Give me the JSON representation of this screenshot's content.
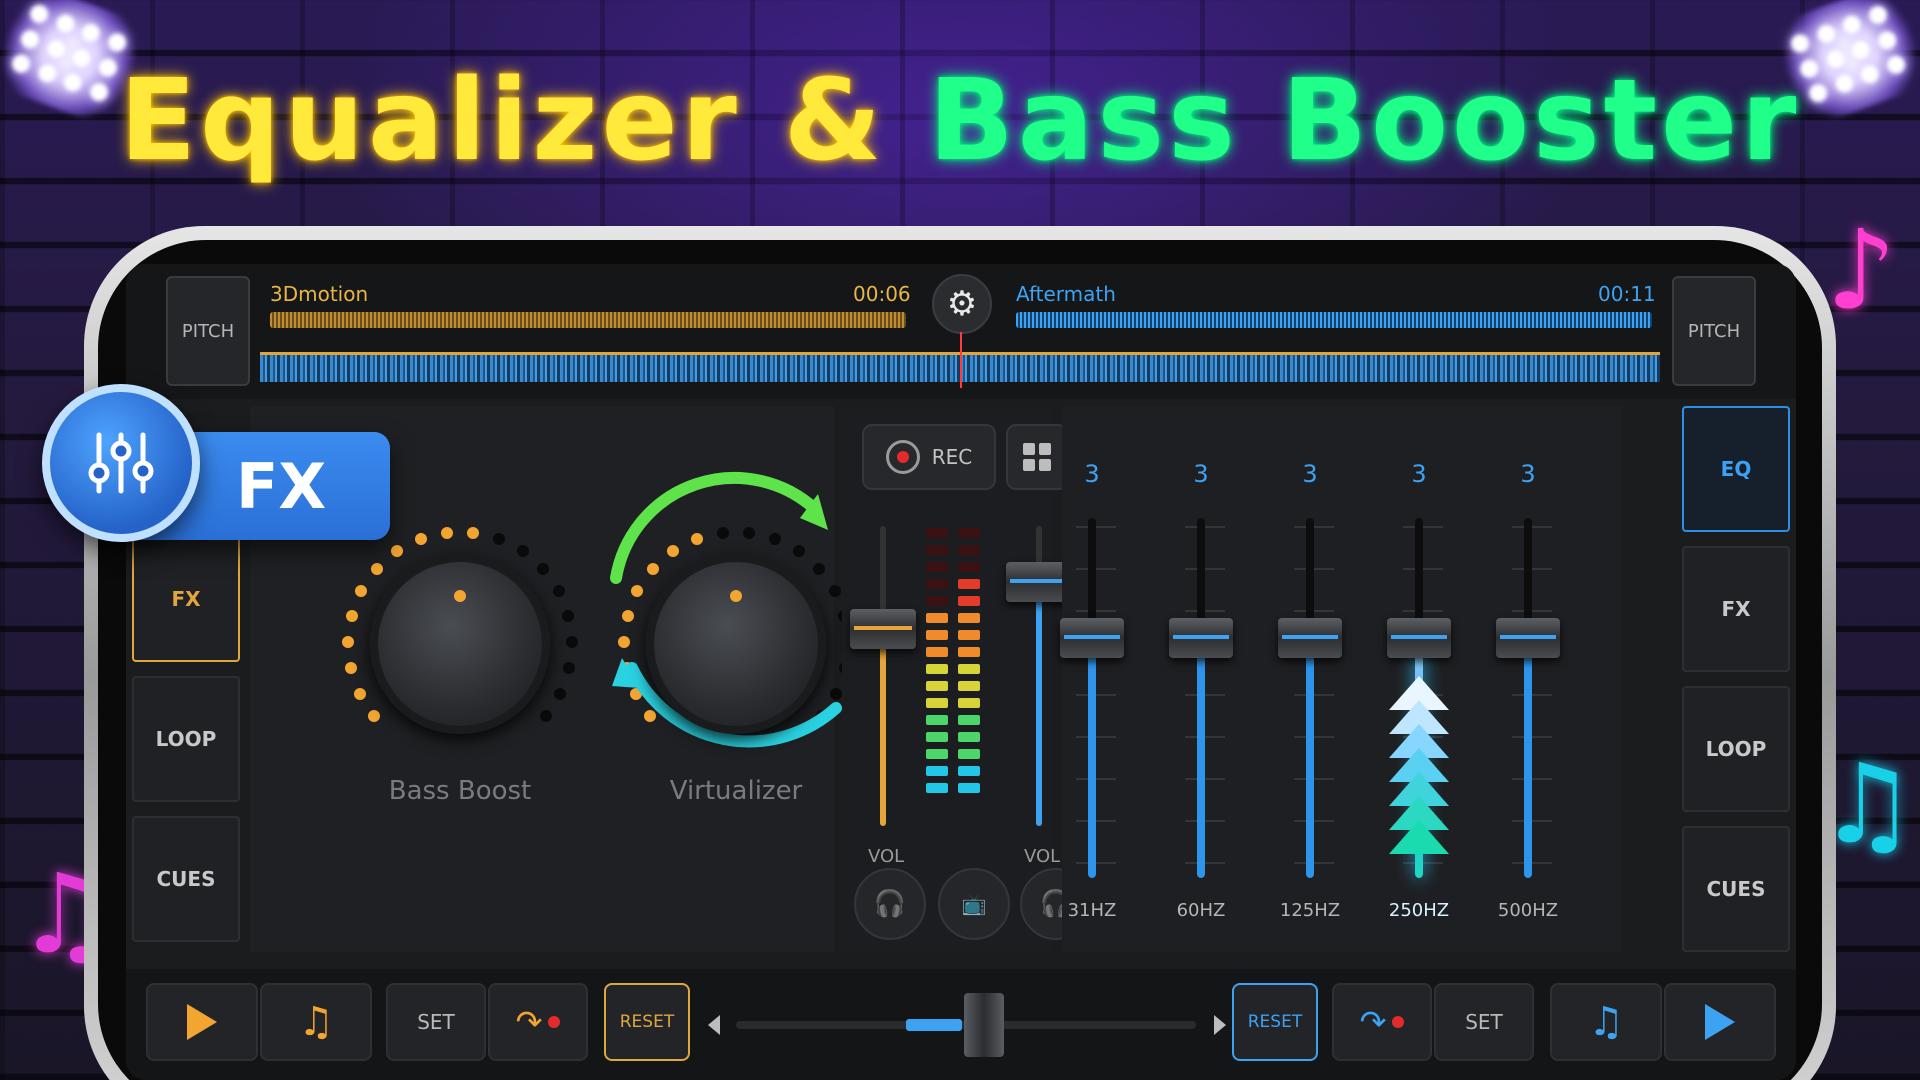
{
  "headline": {
    "part1": "Equalizer &",
    "part2": "Bass Booster"
  },
  "deck_left": {
    "pitch_label": "PITCH",
    "track": "3Dmotion",
    "time": "00:06"
  },
  "deck_right": {
    "pitch_label": "PITCH",
    "track": "Aftermath",
    "time": "00:11"
  },
  "settings_icon": "gear-icon",
  "left_tabs": [
    "FX",
    "LOOP",
    "CUES"
  ],
  "right_tabs": [
    "EQ",
    "FX",
    "LOOP",
    "CUES"
  ],
  "fx_badge": {
    "label": "FX",
    "icon": "sliders-icon"
  },
  "knobs": {
    "bass_boost": "Bass Boost",
    "virtualizer": "Virtualizer"
  },
  "mixer": {
    "rec_label": "REC",
    "vol_left": "VOL",
    "vol_right": "VOL",
    "left_level": 0.68,
    "right_level": 0.86
  },
  "eq": {
    "bands": [
      {
        "label": "31HZ",
        "value": "3"
      },
      {
        "label": "60HZ",
        "value": "3"
      },
      {
        "label": "125HZ",
        "value": "3"
      },
      {
        "label": "250HZ",
        "value": "3"
      },
      {
        "label": "500HZ",
        "value": "3"
      }
    ]
  },
  "transport": {
    "set_left": "SET",
    "reset_left": "RESET",
    "reset_right": "RESET",
    "set_right": "SET",
    "crossfader_position": 0.54
  },
  "colors": {
    "accent_left": "#e0a640",
    "accent_right": "#3ea2f2",
    "headline_yellow": "#ffe93a",
    "headline_green": "#1fff8a"
  }
}
